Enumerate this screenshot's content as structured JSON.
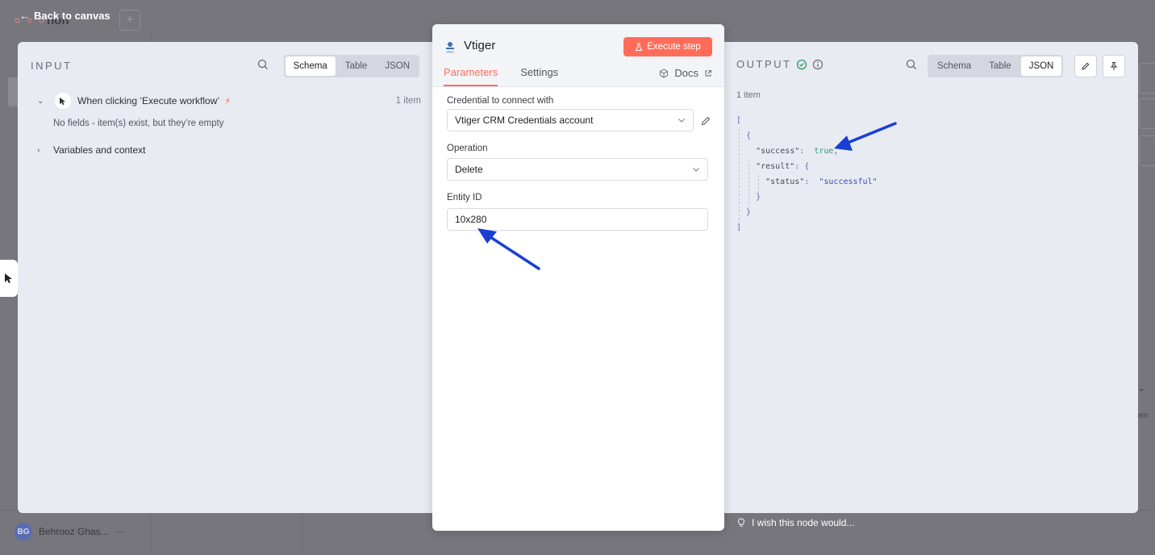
{
  "background": {
    "title": "non",
    "back_label": "Back to canvas",
    "user_initials": "BG",
    "user_name": "Behrooz Ghas...",
    "user_menu": "···",
    "right_edge_text": "em"
  },
  "input": {
    "title": "INPUT",
    "tabs": [
      "Schema",
      "Table",
      "JSON"
    ],
    "active_tab": "Schema",
    "trigger_label": "When clicking ‘Execute workflow’",
    "trigger_count": "1 item",
    "empty_note": "No fields - item(s) exist, but they’re empty",
    "variables_label": "Variables and context"
  },
  "node": {
    "logo_text": "vtiger",
    "name": "Vtiger",
    "execute_label": "Execute step",
    "tabs": [
      "Parameters",
      "Settings"
    ],
    "active_tab": "Parameters",
    "docs_label": "Docs",
    "fields": {
      "credential_label": "Credential to connect with",
      "credential_value": "Vtiger CRM Credentials account",
      "operation_label": "Operation",
      "operation_value": "Delete",
      "entity_label": "Entity ID",
      "entity_value": "10x280"
    }
  },
  "output": {
    "title": "OUTPUT",
    "tabs": [
      "Schema",
      "Table",
      "JSON"
    ],
    "active_tab": "JSON",
    "count": "1 item",
    "json": {
      "success_key": "\"success\"",
      "success_value": "true",
      "result_key": "\"result\"",
      "status_key": "\"status\"",
      "status_value": "\"successful\""
    }
  },
  "footer": {
    "wish_label": "I wish this node would..."
  },
  "colors": {
    "accent": "#ff6d5a",
    "annotation_arrow": "#1a3fd6",
    "success": "#2a9d6c"
  }
}
